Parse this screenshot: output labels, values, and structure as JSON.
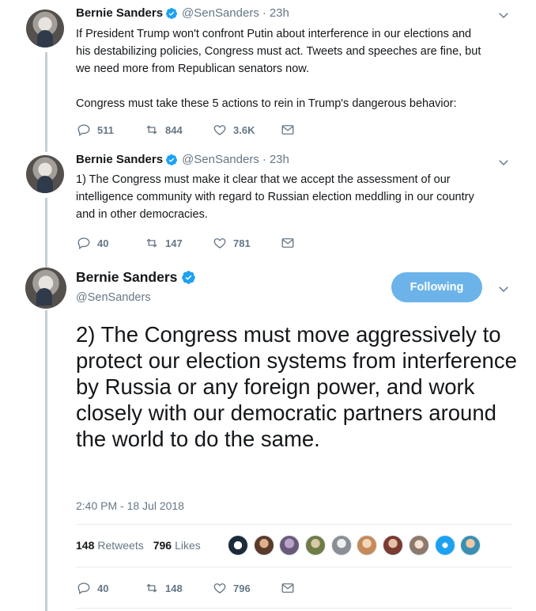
{
  "tweets": [
    {
      "name": "Bernie Sanders",
      "handle": "@SenSanders",
      "time": "23h",
      "text": "If President Trump won't confront Putin about interference in our elections and\nhis destabilizing policies, Congress must act. Tweets and speeches are fine, but\nwe need more from Republican senators now.\n\nCongress must take these 5 actions to rein in Trump's dangerous behavior:",
      "replies": "511",
      "retweets": "844",
      "likes": "3.6K"
    },
    {
      "name": "Bernie Sanders",
      "handle": "@SenSanders",
      "time": "23h",
      "text": "1) The Congress must make it clear that we accept the assessment of our\nintelligence community with regard to Russian election meddling in our country\nand in other democracies.",
      "replies": "40",
      "retweets": "147",
      "likes": "781"
    }
  ],
  "main": {
    "name": "Bernie Sanders",
    "handle": "@SenSanders",
    "follow_label": "Following",
    "text": "2) The Congress must move aggressively to protect our election systems from interference by Russia or any foreign power, and work closely with our democratic partners around the world to do the same.",
    "timestamp": "2:40 PM - 18 Jul 2018",
    "retweet_count": "148",
    "retweet_label": "Retweets",
    "like_count": "796",
    "like_label": "Likes",
    "replies": "40",
    "retweets": "148",
    "likes": "796"
  },
  "colors": {
    "accent": "#1da1f2",
    "follow_button": "#6cb3ea",
    "muted": "#657786",
    "thread_line": "#c4cfd6"
  },
  "icons": [
    "reply-icon",
    "retweet-icon",
    "like-icon",
    "dm-icon",
    "verified-icon",
    "chevron-down-icon"
  ]
}
